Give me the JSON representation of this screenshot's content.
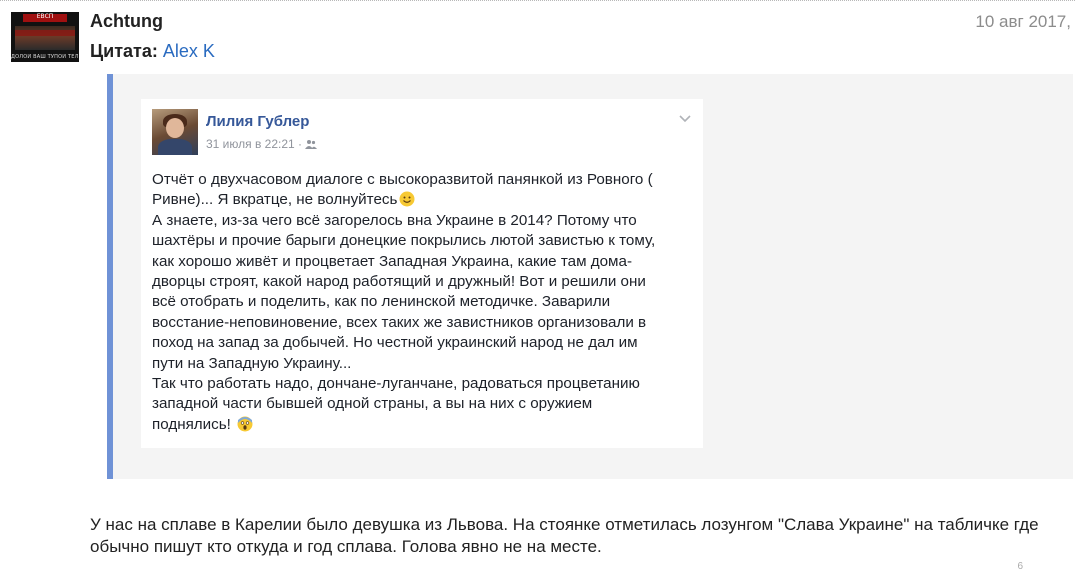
{
  "post": {
    "author": "Achtung",
    "date": "10 авг 2017,",
    "avatar_caption": "ДОЛОЙ ВАШ ТУПОЙ ТЕЛЕК",
    "avatar_header": "ЕВСП",
    "quote": {
      "label": "Цитата:",
      "author": "Alex K"
    },
    "reply_text": "У нас на сплаве в Карелии было девушка из Львова. На стоянке отметилась лозунгом \"Слава Украине\" на табличке где обычно пишут кто откуда и год сплава. Голова явно не на месте.",
    "corner_mark": "6"
  },
  "fb_post": {
    "author": "Лилия Гублер",
    "time": "31 июля в 22:21 ·",
    "para1": "Отчёт о двухчасовом диалоге с высокоразвитой панянкой из Ровного (\nРивне)... Я вкратце, не волнуйтесь",
    "para2": "А знаете, из-за чего всё загорелось вна Украине в 2014? Потому что\nшахтёры и прочие барыги донецкие покрылись лютой завистью к тому,\nкак хорошо живёт и процветает Западная Украина, какие там дома-\nдворцы строят, какой народ работящий и дружный! Вот и решили они\nвсё отобрать и поделить, как по ленинской методичке. Заварили\nвосстание-неповиновение, всех таких же завистников организовали в\nпоход на запад за добычей. Но честной украинский народ не дал им\nпути на Западную Украину...",
    "para3": "Так что работать надо, дончане-луганчане, радоваться процветанию\nзападной части бывшей одной страны, а вы на них с оружием\nподнялись!",
    "icons": {
      "audience": "friends-icon",
      "menu": "chevron-down-icon",
      "emoji1": "smile-emoji-icon",
      "emoji2": "scream-emoji-icon"
    }
  },
  "colors": {
    "quote_border": "#6f92d6",
    "quote_bg": "#f4f4f4",
    "link": "#2a6bc0",
    "fb_name": "#365899"
  }
}
